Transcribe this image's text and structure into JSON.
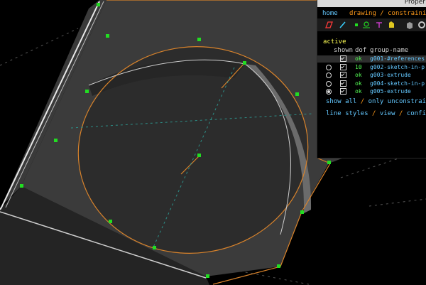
{
  "window": {
    "title": "Proper"
  },
  "nav": {
    "home": "home",
    "sep": "/",
    "current": "drawing / constraining"
  },
  "toolbar": {
    "icons": [
      "sketch-plane-icon",
      "pencil-icon",
      "point-icon",
      "constraint-icon",
      "magenta-constraint-icon",
      "yellow-shape-icon",
      "gray-cube-icon",
      "gear-icon"
    ]
  },
  "groups_table": {
    "active_header": "active",
    "col_shown": "shown",
    "col_dof": "dof",
    "col_name": "group-name",
    "rows": [
      {
        "active": false,
        "shown": true,
        "dof": "ok",
        "name": "g001-#references"
      },
      {
        "active": false,
        "shown": true,
        "dof": "10",
        "name": "g002-sketch-in-p"
      },
      {
        "active": false,
        "shown": true,
        "dof": "ok",
        "name": "g003-extrude"
      },
      {
        "active": false,
        "shown": true,
        "dof": "ok",
        "name": "g004-sketch-in-p"
      },
      {
        "active": true,
        "shown": true,
        "dof": "ok",
        "name": "g005-extrude"
      }
    ]
  },
  "links": {
    "show_all": "show all",
    "slash": "/",
    "only_unconstrained": "only unconstraine",
    "line_styles": "line styles",
    "view": "view",
    "configure": "configu"
  },
  "colors": {
    "edge": "#d9832b",
    "point": "#22dd22",
    "face": "#2f2f2f",
    "background": "#000000"
  }
}
